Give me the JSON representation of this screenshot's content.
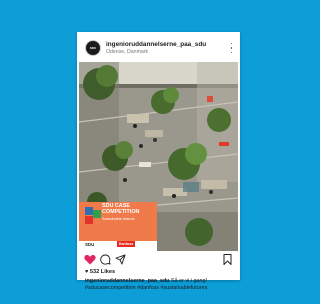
{
  "post": {
    "username": "ingenioruddannelserne_paa_sdu",
    "location": "Odense, Danmark",
    "avatar_text": "SDU",
    "likes": "532 Likes",
    "caption_user": "ingenioruddannelserne_paa_sdu",
    "caption_text": " Så er vi i gang! #sducasecompetition #danfoss #sustainablefutures"
  },
  "overlay": {
    "title_line1": "SDU CASE",
    "title_line2": "COMPETITION",
    "subtitle": "Sustainable futures",
    "logo_left": "SDU",
    "logo_right": "Danfoss"
  },
  "colors": {
    "background": "#0d9ed8",
    "overlay_orange": "#f07a4a",
    "like_red": "#e0245e"
  }
}
